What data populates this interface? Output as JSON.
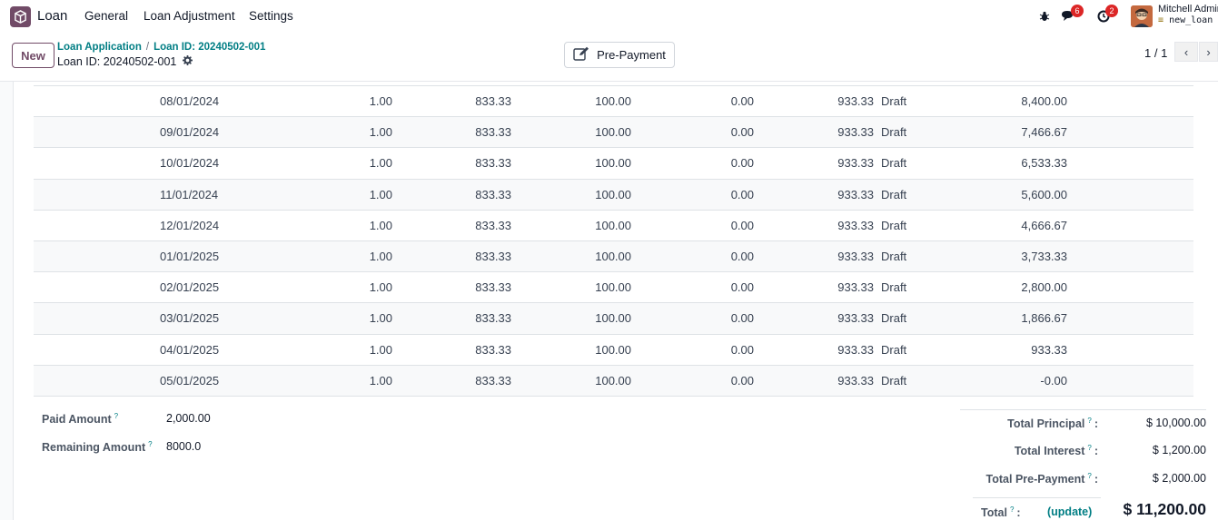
{
  "navbar": {
    "app_name": "Loan",
    "menu": [
      "General",
      "Loan Adjustment",
      "Settings"
    ],
    "messages_count": "6",
    "activities_count": "2",
    "user_name": "Mitchell Admin",
    "database": "new_loan"
  },
  "control": {
    "new_label": "New",
    "breadcrumb": [
      "Loan Application",
      "Loan ID: 20240502-001"
    ],
    "record_title": "Loan ID: 20240502-001",
    "action_button": "Pre-Payment",
    "pager": "1 / 1"
  },
  "installments": [
    {
      "date": "08/01/2024",
      "qty": "1.00",
      "principal": "833.33",
      "interest": "100.00",
      "prepay": "0.00",
      "total": "933.33",
      "state": "Draft",
      "remaining": "8,400.00"
    },
    {
      "date": "09/01/2024",
      "qty": "1.00",
      "principal": "833.33",
      "interest": "100.00",
      "prepay": "0.00",
      "total": "933.33",
      "state": "Draft",
      "remaining": "7,466.67"
    },
    {
      "date": "10/01/2024",
      "qty": "1.00",
      "principal": "833.33",
      "interest": "100.00",
      "prepay": "0.00",
      "total": "933.33",
      "state": "Draft",
      "remaining": "6,533.33"
    },
    {
      "date": "11/01/2024",
      "qty": "1.00",
      "principal": "833.33",
      "interest": "100.00",
      "prepay": "0.00",
      "total": "933.33",
      "state": "Draft",
      "remaining": "5,600.00"
    },
    {
      "date": "12/01/2024",
      "qty": "1.00",
      "principal": "833.33",
      "interest": "100.00",
      "prepay": "0.00",
      "total": "933.33",
      "state": "Draft",
      "remaining": "4,666.67"
    },
    {
      "date": "01/01/2025",
      "qty": "1.00",
      "principal": "833.33",
      "interest": "100.00",
      "prepay": "0.00",
      "total": "933.33",
      "state": "Draft",
      "remaining": "3,733.33"
    },
    {
      "date": "02/01/2025",
      "qty": "1.00",
      "principal": "833.33",
      "interest": "100.00",
      "prepay": "0.00",
      "total": "933.33",
      "state": "Draft",
      "remaining": "2,800.00"
    },
    {
      "date": "03/01/2025",
      "qty": "1.00",
      "principal": "833.33",
      "interest": "100.00",
      "prepay": "0.00",
      "total": "933.33",
      "state": "Draft",
      "remaining": "1,866.67"
    },
    {
      "date": "04/01/2025",
      "qty": "1.00",
      "principal": "833.33",
      "interest": "100.00",
      "prepay": "0.00",
      "total": "933.33",
      "state": "Draft",
      "remaining": "933.33"
    },
    {
      "date": "05/01/2025",
      "qty": "1.00",
      "principal": "833.33",
      "interest": "100.00",
      "prepay": "0.00",
      "total": "933.33",
      "state": "Draft",
      "remaining": "-0.00"
    }
  ],
  "amounts": {
    "paid_label": "Paid Amount",
    "paid_value": "2,000.00",
    "remaining_label": "Remaining Amount",
    "remaining_value": "8000.0"
  },
  "summary": {
    "principal_label": "Total Principal",
    "principal_value": "$ 10,000.00",
    "interest_label": "Total Interest",
    "interest_value": "$ 1,200.00",
    "prepayment_label": "Total Pre-Payment",
    "prepayment_value": "$ 2,000.00",
    "total_label": "Total",
    "update_label": "(update)",
    "total_value": "$ 11,200.00"
  },
  "help_mark": "?",
  "colon": ":"
}
